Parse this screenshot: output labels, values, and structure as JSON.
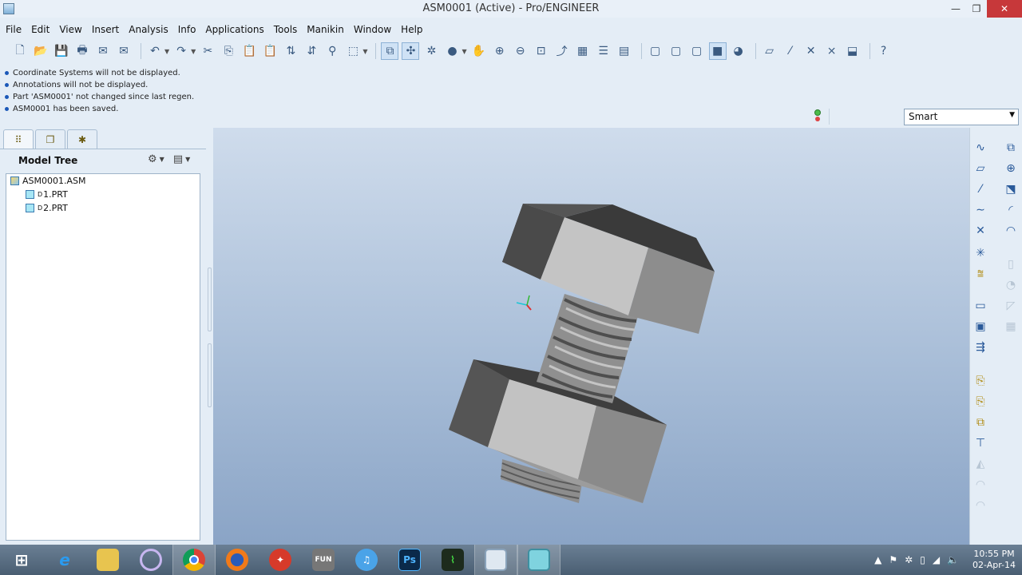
{
  "window": {
    "title": "ASM0001 (Active) - Pro/ENGINEER",
    "min_glyph": "—",
    "max_glyph": "❐",
    "close_glyph": "✕"
  },
  "menu": [
    "File",
    "Edit",
    "View",
    "Insert",
    "Analysis",
    "Info",
    "Applications",
    "Tools",
    "Manikin",
    "Window",
    "Help"
  ],
  "messages": [
    "Coordinate Systems will not be displayed.",
    "Annotations will not be displayed.",
    "Part 'ASM0001' not changed since last regen.",
    "ASM0001 has been saved."
  ],
  "filter": {
    "value": "Smart",
    "arrow": "▼"
  },
  "navigator": {
    "header": "Model Tree",
    "tree": [
      {
        "label": "ASM0001.ASM",
        "type": "asm",
        "prefix": ""
      },
      {
        "label": "1.PRT",
        "type": "prt",
        "prefix": "D"
      },
      {
        "label": "2.PRT",
        "type": "prt",
        "prefix": "D"
      }
    ]
  },
  "icons": {
    "toolbar": [
      "new-icon",
      "open-icon",
      "save-icon",
      "print-icon",
      "email-icon",
      "email-link-icon",
      "undo-icon",
      "redo-icon",
      "cut-icon",
      "copy-icon",
      "paste-icon",
      "paste-special-icon",
      "regenerate-icon",
      "regen-manager-icon",
      "find-icon",
      "select-box-icon",
      "redraw-icon",
      "spin-center-icon",
      "orient-icon",
      "appearance-icon",
      "pan-icon",
      "zoom-in-icon",
      "zoom-out-icon",
      "refit-icon",
      "reorient-icon",
      "saved-views-icon",
      "layers-icon",
      "view-manager-icon",
      "wireframe-icon",
      "hidden-line-icon",
      "no-hidden-icon",
      "shading-icon",
      "enhanced-realism-icon",
      "datum-planes-icon",
      "datum-axes-icon",
      "datum-points-icon",
      "csys-icon",
      "annotation-display-icon",
      "context-help-icon"
    ],
    "right_toolbar": [
      "sketch-icon",
      "datum-plane-icon",
      "datum-axis-icon",
      "datum-curve-icon",
      "datum-point-icon",
      "csys-tool-icon",
      "analysis-feature-icon",
      "component-add-icon",
      "component-create-icon",
      "component-repeat-icon",
      "extrude-icon",
      "revolve-icon",
      "hole-icon",
      "round-icon",
      "chamfer-icon",
      "shell-icon",
      "draft-icon",
      "rib-icon",
      "pattern-icon",
      "mirror-icon",
      "merge-icon"
    ],
    "taskbar": [
      "windows-start-icon",
      "internet-explorer-icon",
      "file-explorer-icon",
      "media-app-icon",
      "chrome-icon",
      "firefox-icon",
      "flash-app-icon",
      "keyboard-app-icon",
      "itunes-icon",
      "photoshop-icon",
      "system-monitor-icon",
      "proe-window-icon",
      "proe-app-icon"
    ]
  },
  "taskbar": {
    "ps_label": "Ps",
    "fun_label": "FUN",
    "clock_time": "10:55 PM",
    "clock_date": "02-Apr-14"
  },
  "colors": {
    "window_bg": "#e4edf6",
    "viewport_top": "#cfdcec",
    "viewport_bottom": "#8aa4c6",
    "close_button": "#c7383a",
    "message_bullet": "#1b58b8"
  }
}
